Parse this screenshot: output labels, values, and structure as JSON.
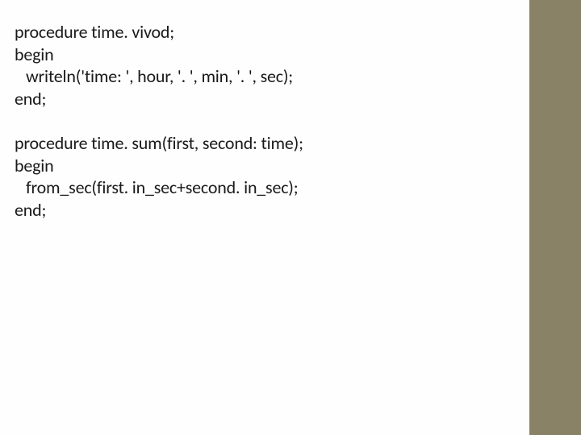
{
  "code": {
    "block1": {
      "line1": "procedure time. vivod;",
      "line2": "begin",
      "line3": "writeln('time: ', hour, '. ', min, '. ', sec);",
      "line4": "end;"
    },
    "block2": {
      "line1": "procedure time. sum(first, second: time);",
      "line2": "begin",
      "line3": "from_sec(first. in_sec+second. in_sec);",
      "line4": "end;"
    }
  }
}
